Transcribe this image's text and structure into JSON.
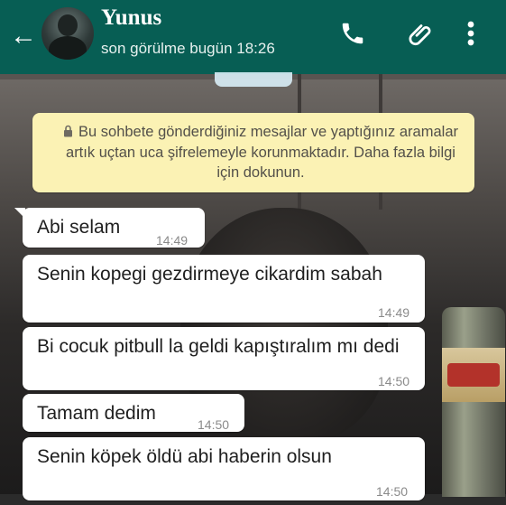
{
  "header": {
    "back_icon": "arrow-left-icon",
    "contact_name": "Yunus",
    "last_seen": "son görülme bugün 18:26",
    "icons": [
      "phone-icon",
      "paperclip-icon",
      "more-vert-icon"
    ],
    "background_color": "#075e54"
  },
  "notice": {
    "lock_icon": "lock-icon",
    "text": "Bu sohbete gönderdiğiniz mesajlar ve yaptığınız aramalar artık uçtan uca şifrelemeyle korunmaktadır. Daha fazla bilgi için dokunun.",
    "background_color": "#fbf2b4"
  },
  "messages": [
    {
      "text": "Abi selam",
      "time": "14:49"
    },
    {
      "text": "Senin kopegi gezdirmeye cikardim sabah",
      "time": "14:49"
    },
    {
      "text": "Bi cocuk pitbull la geldi kapıştıralım mı dedi",
      "time": "14:50"
    },
    {
      "text": "Tamam dedim",
      "time": "14:50"
    },
    {
      "text": "Senin köpek öldü abi haberin olsun",
      "time": "14:50"
    }
  ]
}
